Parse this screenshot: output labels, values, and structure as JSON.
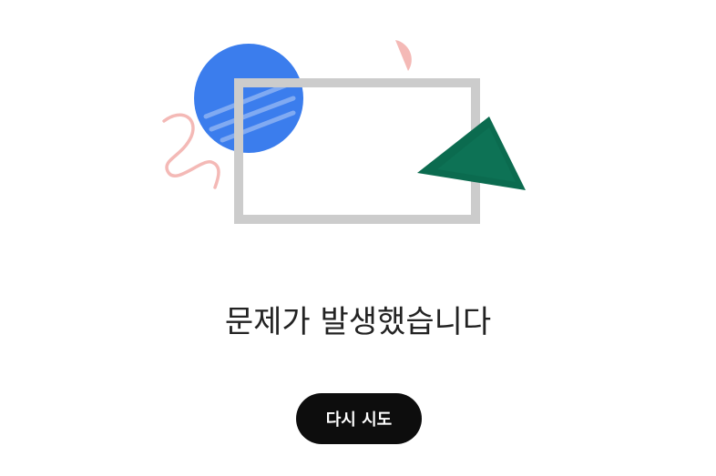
{
  "error": {
    "title": "문제가 발생했습니다",
    "retry_label": "다시 시도"
  },
  "illustration": {
    "name": "broken-window-illustration",
    "colors": {
      "circle": "#3b7ded",
      "frame": "#cccccc",
      "triangle": "#0b6b4f",
      "accent": "#f4b9b6"
    }
  }
}
